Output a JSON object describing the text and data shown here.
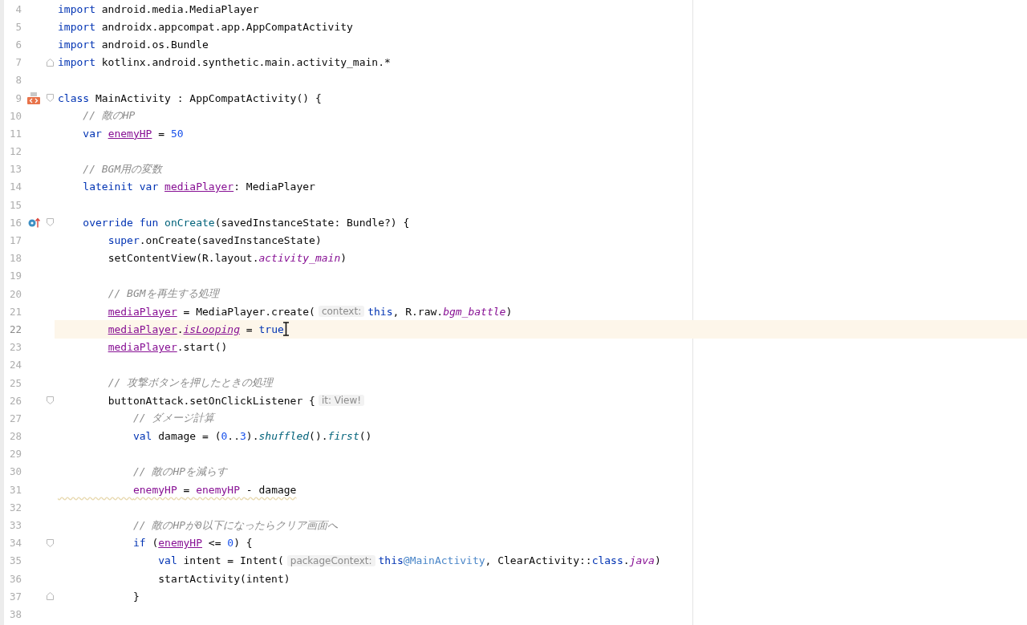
{
  "editor": {
    "lines": [
      {
        "number": "4",
        "current": false,
        "segments": [
          {
            "kind": "code",
            "tokens": [
              {
                "kind": "keyword",
                "text": "import "
              },
              {
                "kind": "plain",
                "text": "android.media.MediaPlayer"
              }
            ]
          }
        ]
      },
      {
        "number": "5",
        "current": false,
        "segments": [
          {
            "kind": "code",
            "tokens": [
              {
                "kind": "keyword",
                "text": "import "
              },
              {
                "kind": "plain",
                "text": "androidx.appcompat.app.AppCompatActivity"
              }
            ]
          }
        ]
      },
      {
        "number": "6",
        "current": false,
        "segments": [
          {
            "kind": "code",
            "tokens": [
              {
                "kind": "keyword",
                "text": "import "
              },
              {
                "kind": "plain",
                "text": "android.os.Bundle"
              }
            ]
          }
        ]
      },
      {
        "number": "7",
        "current": false,
        "fold_marker": {
          "kind": "end"
        },
        "segments": [
          {
            "kind": "code",
            "tokens": [
              {
                "kind": "keyword",
                "text": "import "
              },
              {
                "kind": "plain",
                "text": "kotlinx.android.synthetic.main.activity_main.*"
              }
            ]
          }
        ]
      },
      {
        "number": "8",
        "current": false
      },
      {
        "number": "9",
        "current": false,
        "fold_marker": {
          "kind": "start"
        },
        "gutter_icon": {
          "kind": "layout"
        },
        "segments": [
          {
            "kind": "code",
            "tokens": [
              {
                "kind": "keyword",
                "text": "class "
              },
              {
                "kind": "plain",
                "text": "MainActivity : AppCompatActivity() {"
              }
            ]
          }
        ]
      },
      {
        "number": "10",
        "current": false,
        "segments": [
          {
            "kind": "code",
            "tokens": [
              {
                "kind": "comment",
                "text": "    // 敵のHP"
              }
            ]
          }
        ]
      },
      {
        "number": "11",
        "current": false,
        "segments": [
          {
            "kind": "code",
            "tokens": [
              {
                "kind": "keyword",
                "text": "    var "
              },
              {
                "kind": "property",
                "text": "enemyHP"
              },
              {
                "kind": "plain",
                "text": " = "
              },
              {
                "kind": "number",
                "text": "50"
              }
            ]
          }
        ]
      },
      {
        "number": "12",
        "current": false
      },
      {
        "number": "13",
        "current": false,
        "segments": [
          {
            "kind": "code",
            "tokens": [
              {
                "kind": "comment",
                "text": "    // BGM用の変数"
              }
            ]
          }
        ]
      },
      {
        "number": "14",
        "current": false,
        "segments": [
          {
            "kind": "code",
            "tokens": [
              {
                "kind": "keyword",
                "text": "    lateinit var "
              },
              {
                "kind": "property",
                "text": "mediaPlayer"
              },
              {
                "kind": "plain",
                "text": ": MediaPlayer"
              }
            ]
          }
        ]
      },
      {
        "number": "15",
        "current": false
      },
      {
        "number": "16",
        "current": false,
        "fold_marker": {
          "kind": "start"
        },
        "gutter_icon": {
          "kind": "override"
        },
        "segments": [
          {
            "kind": "code",
            "tokens": [
              {
                "kind": "keyword",
                "text": "    override fun "
              },
              {
                "kind": "function",
                "text": "onCreate"
              },
              {
                "kind": "plain",
                "text": "(savedInstanceState: Bundle?) {"
              }
            ]
          }
        ]
      },
      {
        "number": "17",
        "current": false,
        "segments": [
          {
            "kind": "code",
            "tokens": [
              {
                "kind": "keyword",
                "text": "        super"
              },
              {
                "kind": "plain",
                "text": ".onCreate(savedInstanceState)"
              }
            ]
          }
        ]
      },
      {
        "number": "18",
        "current": false,
        "segments": [
          {
            "kind": "code",
            "tokens": [
              {
                "kind": "plain",
                "text": "        setContentView(R.layout."
              },
              {
                "kind": "constant",
                "text": "activity_main"
              },
              {
                "kind": "plain",
                "text": ")"
              }
            ]
          }
        ]
      },
      {
        "number": "19",
        "current": false
      },
      {
        "number": "20",
        "current": false,
        "segments": [
          {
            "kind": "code",
            "tokens": [
              {
                "kind": "comment",
                "text": "        // BGMを再生する処理"
              }
            ]
          }
        ]
      },
      {
        "number": "21",
        "current": false,
        "segments": [
          {
            "kind": "code",
            "tokens": [
              {
                "kind": "property",
                "text": "        mediaPlayer"
              },
              {
                "kind": "plain",
                "text": " = MediaPlayer.create("
              }
            ]
          },
          {
            "kind": "hint",
            "text": "context:"
          },
          {
            "kind": "code",
            "tokens": [
              {
                "kind": "keyword",
                "text": "this"
              },
              {
                "kind": "plain",
                "text": ", R.raw."
              },
              {
                "kind": "constant",
                "text": "bgm_battle"
              },
              {
                "kind": "plain",
                "text": ")"
              }
            ]
          }
        ]
      },
      {
        "number": "22",
        "current": true,
        "pointer": true,
        "segments": [
          {
            "kind": "code",
            "tokens": [
              {
                "kind": "property",
                "text": "        mediaPlayer"
              },
              {
                "kind": "plain",
                "text": "."
              },
              {
                "kind": "property-italic",
                "text": "isLooping"
              },
              {
                "kind": "plain",
                "text": " = "
              },
              {
                "kind": "keyword",
                "text": "true"
              }
            ]
          }
        ]
      },
      {
        "number": "23",
        "current": false,
        "segments": [
          {
            "kind": "code",
            "tokens": [
              {
                "kind": "property",
                "text": "        mediaPlayer"
              },
              {
                "kind": "plain",
                "text": ".start()"
              }
            ]
          }
        ]
      },
      {
        "number": "24",
        "current": false
      },
      {
        "number": "25",
        "current": false,
        "segments": [
          {
            "kind": "code",
            "tokens": [
              {
                "kind": "comment",
                "text": "        // 攻撃ボタンを押したときの処理"
              }
            ]
          }
        ]
      },
      {
        "number": "26",
        "current": false,
        "fold_marker": {
          "kind": "start"
        },
        "segments": [
          {
            "kind": "code",
            "tokens": [
              {
                "kind": "plain",
                "text": "        buttonAttack.setOnClickListener {"
              }
            ]
          },
          {
            "kind": "hint",
            "text": "it: View!"
          }
        ]
      },
      {
        "number": "27",
        "current": false,
        "segments": [
          {
            "kind": "code",
            "tokens": [
              {
                "kind": "comment",
                "text": "            // ダメージ計算"
              }
            ]
          }
        ]
      },
      {
        "number": "28",
        "current": false,
        "segments": [
          {
            "kind": "code",
            "tokens": [
              {
                "kind": "keyword",
                "text": "            val "
              },
              {
                "kind": "plain",
                "text": "damage = ("
              },
              {
                "kind": "number",
                "text": "0"
              },
              {
                "kind": "plain",
                "text": ".."
              },
              {
                "kind": "number",
                "text": "3"
              },
              {
                "kind": "plain",
                "text": ")."
              },
              {
                "kind": "extension",
                "text": "shuffled"
              },
              {
                "kind": "plain",
                "text": "()."
              },
              {
                "kind": "extension",
                "text": "first"
              },
              {
                "kind": "plain",
                "text": "()"
              }
            ]
          }
        ]
      },
      {
        "number": "29",
        "current": false
      },
      {
        "number": "30",
        "current": false,
        "segments": [
          {
            "kind": "code",
            "tokens": [
              {
                "kind": "comment",
                "text": "            // 敵のHPを減らす"
              }
            ]
          }
        ]
      },
      {
        "number": "31",
        "current": false,
        "segments": [
          {
            "kind": "code",
            "warning": true,
            "tokens": [
              {
                "kind": "field",
                "text": "            enemyHP"
              },
              {
                "kind": "plain",
                "text": " = "
              },
              {
                "kind": "field",
                "text": "enemyHP"
              },
              {
                "kind": "plain",
                "text": " - damage"
              }
            ]
          }
        ]
      },
      {
        "number": "32",
        "current": false
      },
      {
        "number": "33",
        "current": false,
        "segments": [
          {
            "kind": "code",
            "tokens": [
              {
                "kind": "comment",
                "text": "            // 敵のHPが0以下になったらクリア画面へ"
              }
            ]
          }
        ]
      },
      {
        "number": "34",
        "current": false,
        "fold_marker": {
          "kind": "start"
        },
        "segments": [
          {
            "kind": "code",
            "tokens": [
              {
                "kind": "keyword",
                "text": "            if "
              },
              {
                "kind": "plain",
                "text": "("
              },
              {
                "kind": "property",
                "text": "enemyHP"
              },
              {
                "kind": "plain",
                "text": " <= "
              },
              {
                "kind": "number",
                "text": "0"
              },
              {
                "kind": "plain",
                "text": ") {"
              }
            ]
          }
        ]
      },
      {
        "number": "35",
        "current": false,
        "segments": [
          {
            "kind": "code",
            "tokens": [
              {
                "kind": "keyword",
                "text": "                val "
              },
              {
                "kind": "plain",
                "text": "intent = Intent("
              }
            ]
          },
          {
            "kind": "hint",
            "text": "packageContext:"
          },
          {
            "kind": "code",
            "tokens": [
              {
                "kind": "keyword",
                "text": "this"
              },
              {
                "kind": "label",
                "text": "@MainActivity"
              },
              {
                "kind": "plain",
                "text": ", ClearActivity::"
              },
              {
                "kind": "keyword",
                "text": "class"
              },
              {
                "kind": "plain",
                "text": "."
              },
              {
                "kind": "constant",
                "text": "java"
              },
              {
                "kind": "plain",
                "text": ")"
              }
            ]
          }
        ]
      },
      {
        "number": "36",
        "current": false,
        "segments": [
          {
            "kind": "code",
            "tokens": [
              {
                "kind": "plain",
                "text": "                startActivity(intent)"
              }
            ]
          }
        ]
      },
      {
        "number": "37",
        "current": false,
        "fold_marker": {
          "kind": "end"
        },
        "segments": [
          {
            "kind": "code",
            "tokens": [
              {
                "kind": "plain",
                "text": "            }"
              }
            ]
          }
        ]
      },
      {
        "number": "38",
        "current": false
      }
    ]
  }
}
